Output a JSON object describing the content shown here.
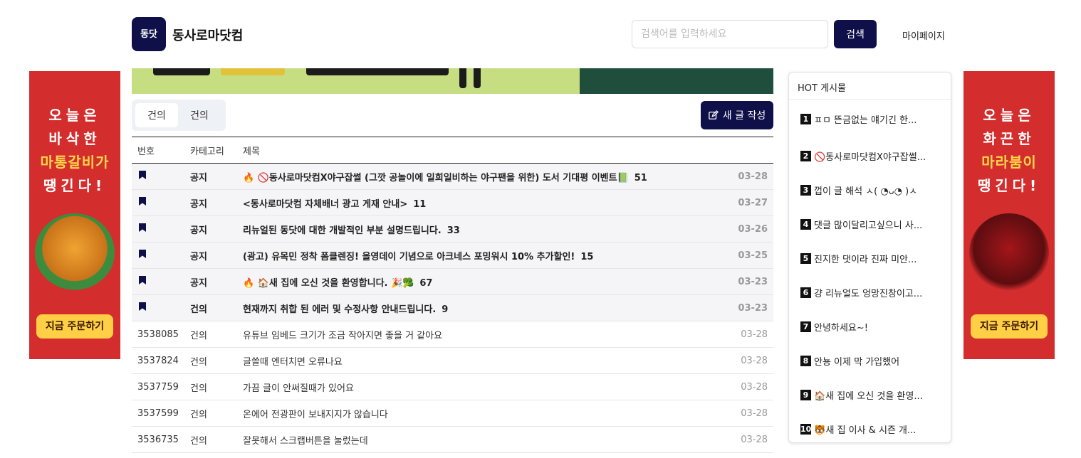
{
  "header": {
    "logo_mark": "동닷",
    "site_name": "동사로마닷컴",
    "search_placeholder": "검색어를 입력하세요",
    "search_button": "검색",
    "mypage": "마이페이지"
  },
  "ad_left": {
    "lines": [
      "오늘은",
      "바삭한",
      "마통갈비가",
      "땡긴다!"
    ],
    "button": "지금 주문하기"
  },
  "ad_right": {
    "lines": [
      "오늘은",
      "화끈한",
      "마라붐이",
      "땡긴다!"
    ],
    "button": "지금 주문하기"
  },
  "tabs": [
    "건의",
    "건의"
  ],
  "write_button": "새 글 작성",
  "table": {
    "headers": {
      "num": "번호",
      "category": "카테고리",
      "title": "제목"
    },
    "rows": [
      {
        "num": "",
        "category": "공지",
        "title": "🔥 🚫동사로마닷컴X야구잡썰 (그깟 공놀이에 일희일비하는 야구팬을 위한) 도서 기대평 이벤트📗",
        "count": "51",
        "date": "03-28",
        "notice": true
      },
      {
        "num": "",
        "category": "공지",
        "title": "<동사로마닷컴 자체배너 광고 게재 안내>",
        "count": "11",
        "date": "03-27",
        "notice": true
      },
      {
        "num": "",
        "category": "공지",
        "title": "리뉴얼된 동닷에 대한 개발적인 부분 설명드립니다.",
        "count": "33",
        "date": "03-26",
        "notice": true
      },
      {
        "num": "",
        "category": "공지",
        "title": "(광고) 유목민 정착 폼클렌징! 올영데이 기념으로 아크네스 포밍워시 10% 추가할인!",
        "count": "15",
        "date": "03-25",
        "notice": true
      },
      {
        "num": "",
        "category": "공지",
        "title": "🔥 🏠새 집에 오신 것을 환영합니다. 🎉🥦",
        "count": "67",
        "date": "03-23",
        "notice": true
      },
      {
        "num": "",
        "category": "건의",
        "title": "현재까지 취합 된 에러 및 수정사항 안내드립니다.",
        "count": "9",
        "date": "03-23",
        "notice": true
      },
      {
        "num": "3538085",
        "category": "건의",
        "title": "유튜브 임베드 크기가 조금 작아지면 좋을 거 같아요",
        "count": "",
        "date": "03-28",
        "notice": false
      },
      {
        "num": "3537824",
        "category": "건의",
        "title": "글쓸때 엔터치면 오류나요",
        "count": "",
        "date": "03-28",
        "notice": false
      },
      {
        "num": "3537759",
        "category": "건의",
        "title": "가끔 글이 안써질때가 있어요",
        "count": "",
        "date": "03-28",
        "notice": false
      },
      {
        "num": "3537599",
        "category": "건의",
        "title": "온에어 전광판이 보내지지가 않습니다",
        "count": "",
        "date": "03-28",
        "notice": false
      },
      {
        "num": "3536735",
        "category": "건의",
        "title": "잘못해서 스크랩버튼을 눌렀는데",
        "count": "",
        "date": "03-28",
        "notice": false
      }
    ]
  },
  "hot": {
    "title": "HOT 게시물",
    "items": [
      {
        "rank": "1",
        "text": "ㅍㅁ 뜬금없는 얘기긴 한..."
      },
      {
        "rank": "2",
        "text": "🚫동사로마닷컴X야구잡썰..."
      },
      {
        "rank": "3",
        "text": "껍이 글 해석 ㅅ( ◔ᴗ◔ )ㅅ"
      },
      {
        "rank": "4",
        "text": "댓글 많이달리고싶으니 사..."
      },
      {
        "rank": "5",
        "text": "진지한 댓이라 진짜 미안..."
      },
      {
        "rank": "6",
        "text": "걍 리뉴얼도 엉망진창이고..."
      },
      {
        "rank": "7",
        "text": "안녕하세요~!"
      },
      {
        "rank": "8",
        "text": "안뇽 이제 막 가입했어"
      },
      {
        "rank": "9",
        "text": "🏠새 집에 오신 것을 환영..."
      },
      {
        "rank": "10",
        "text": "🐯새 집 이사 & 시즌 개..."
      }
    ]
  },
  "colors": {
    "brand": "#0f0f4a",
    "ad_red": "#d42d2d",
    "ad_yellow": "#ffcf45"
  }
}
